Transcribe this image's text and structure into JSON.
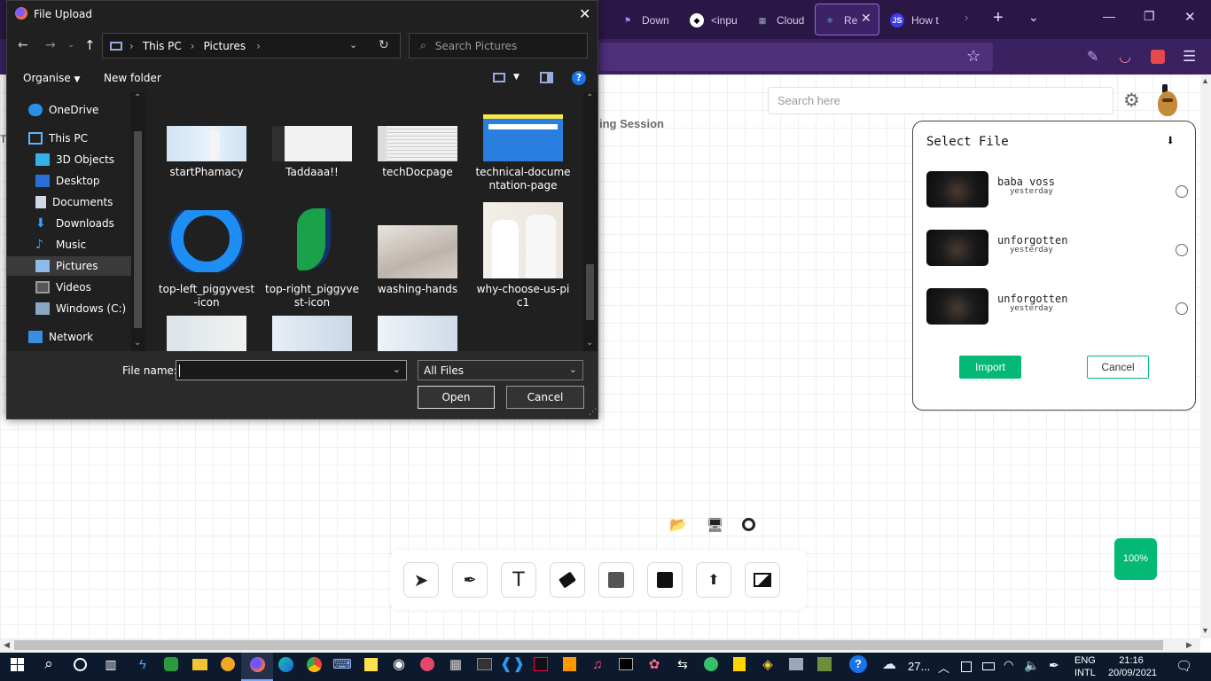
{
  "browser": {
    "tabs": [
      {
        "label": "Down",
        "icon": "flag-icon"
      },
      {
        "label": "<inpu",
        "icon": "glyph-icon"
      },
      {
        "label": "Cloud",
        "icon": "cloud-icon"
      },
      {
        "label": "Rea",
        "icon": "react-icon"
      },
      {
        "label": "How t",
        "icon": "js-icon"
      }
    ]
  },
  "app": {
    "search_placeholder": "Search here",
    "heading_fragment": "ing Session",
    "zoom_label": "100%",
    "file_picker": {
      "title": "Select File",
      "files": [
        {
          "name": "baba voss",
          "date": "yesterday"
        },
        {
          "name": "unforgotten",
          "date": "yesterday"
        },
        {
          "name": "unforgotten",
          "date": "yesterday"
        }
      ],
      "import_label": "Import",
      "cancel_label": "Cancel"
    }
  },
  "dialog": {
    "title": "File Upload",
    "breadcrumb": [
      "This PC",
      "Pictures"
    ],
    "search_placeholder": "Search Pictures",
    "organise_label": "Organise",
    "new_folder_label": "New folder",
    "nav_items": [
      "OneDrive",
      "This PC",
      "3D Objects",
      "Desktop",
      "Documents",
      "Downloads",
      "Music",
      "Pictures",
      "Videos",
      "Windows (C:)",
      "Network"
    ],
    "files_row1": [
      "startPhamacy",
      "Taddaaa!!",
      "techDocpage",
      "technical-documentation-page"
    ],
    "files_row2": [
      "top-left_piggyvest-icon",
      "top-right_piggyvest-icon",
      "washing-hands",
      "why-choose-us-pic1"
    ],
    "file_name_label": "File name:",
    "file_name_value": "",
    "filter_value": "All Files",
    "open_label": "Open",
    "cancel_label": "Cancel"
  },
  "taskbar": {
    "weather": "27...",
    "lang_top": "ENG",
    "lang_bottom": "INTL",
    "time": "21:16",
    "date": "20/09/2021"
  },
  "colors": {
    "browser_bar": "#2b1746",
    "accent_green": "#04b976",
    "dialog_bg": "#202020",
    "taskbar": "#0d1a2e"
  }
}
